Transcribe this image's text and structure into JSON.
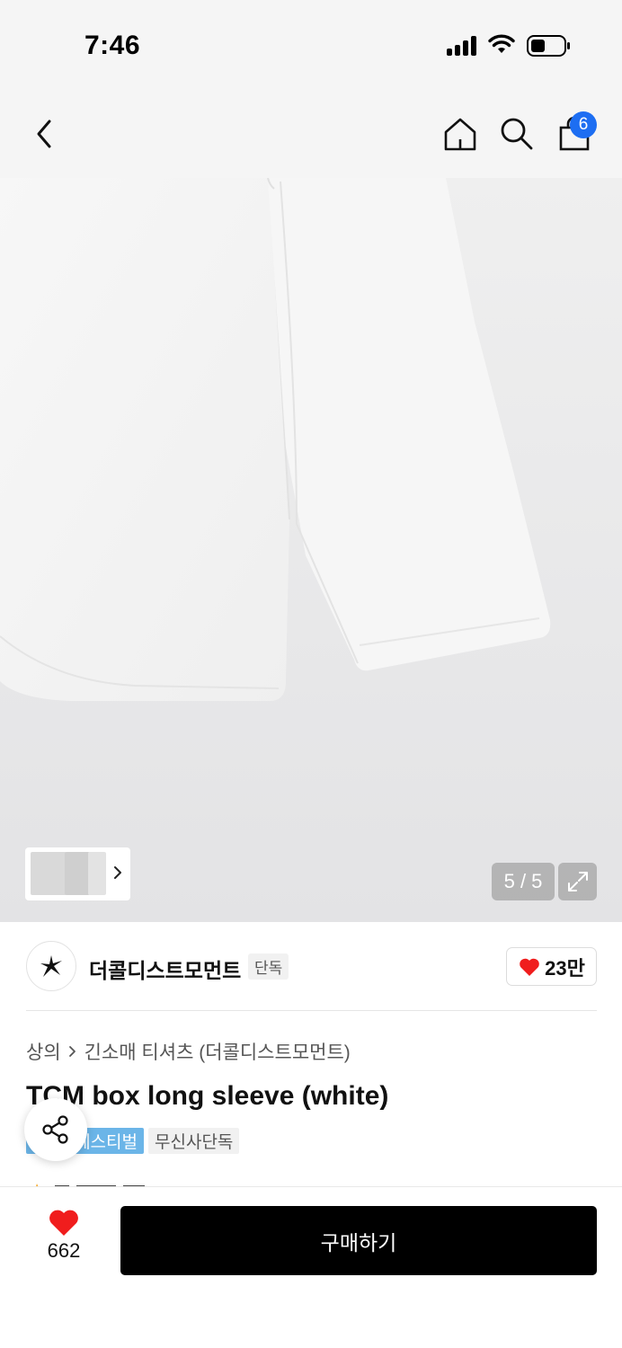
{
  "status_bar": {
    "time": "7:46"
  },
  "nav": {
    "back_icon": "chevron-left-icon",
    "home_icon": "home-icon",
    "search_icon": "search-icon",
    "cart_icon": "shopping-bag-icon",
    "cart_count": "6",
    "badge_color": "#1d6ef2"
  },
  "gallery": {
    "page_indicator": "5 / 5",
    "expand_icon": "expand-icon",
    "thumb_chevron_icon": "chevron-right-icon"
  },
  "brand": {
    "name": "더콜디스트모먼트",
    "exclusive_tag": "단독",
    "like_count": "23만",
    "like_icon": "heart-icon",
    "heart_color": "#f01d1d"
  },
  "product": {
    "breadcrumb": [
      "상의",
      "긴소매 티셔츠 (더콜디스트모먼트)"
    ],
    "title": "TCM box long sleeve (white)",
    "tags": [
      "페스티벌",
      "무신사단독"
    ],
    "festival_color": "#6bb5e8",
    "share_icon": "share-icon"
  },
  "bottom_bar": {
    "like_count": "662",
    "buy_label": "구매하기"
  }
}
